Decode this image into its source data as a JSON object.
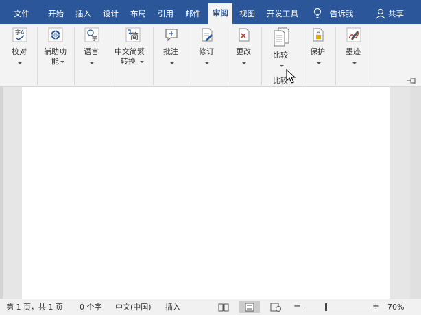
{
  "tabs": {
    "file": "文件",
    "home": "开始",
    "insert": "插入",
    "design": "设计",
    "layout": "布局",
    "references": "引用",
    "mailings": "邮件",
    "review": "审阅",
    "view": "视图",
    "developer": "开发工具",
    "tell_me": "告诉我",
    "share": "共享"
  },
  "ribbon": {
    "proofing": "校对",
    "accessibility_line1": "辅助功",
    "accessibility_line2": "能",
    "language": "语言",
    "chinese_conversion_line1": "中文简繁",
    "chinese_conversion_line2": "转换",
    "comments": "批注",
    "tracking": "修订",
    "changes": "更改",
    "compare": "比较",
    "compare_group": "比较",
    "protect": "保护",
    "ink": "墨迹"
  },
  "statusbar": {
    "page_info": "第 1 页，共 1 页",
    "word_count": "0 个字",
    "language": "中文(中国)",
    "mode": "插入",
    "zoom_minus": "−",
    "zoom_plus": "+",
    "zoom_level": "70%"
  },
  "colors": {
    "tab_bar": "#2b579a",
    "ribbon_bg": "#f3f3f3",
    "doc_bg": "#e6e6e6",
    "page": "#ffffff"
  },
  "icons": {
    "tell_me": "lightbulb-icon",
    "share": "person-icon",
    "proofing": "spelling-icon",
    "accessibility": "accessibility-check-icon",
    "language": "language-icon",
    "chinese_conversion": "simplified-traditional-icon",
    "comments": "new-comment-icon",
    "tracking": "track-changes-icon",
    "changes": "accept-reject-icon",
    "compare": "compare-documents-icon",
    "protect": "lock-document-icon",
    "ink": "pen-ink-icon"
  }
}
